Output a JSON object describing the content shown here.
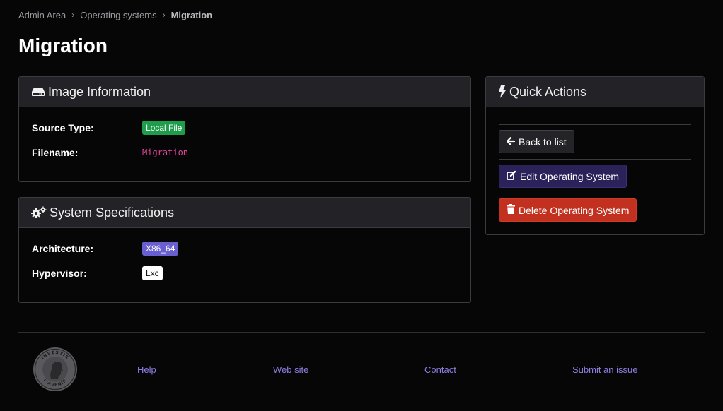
{
  "breadcrumb": {
    "items": [
      "Admin Area",
      "Operating systems"
    ],
    "current": "Migration"
  },
  "page": {
    "title": "Migration"
  },
  "image_info": {
    "title": "Image Information",
    "source_type_label": "Source Type:",
    "source_type_value": "Local File",
    "filename_label": "Filename:",
    "filename_value": "Migration"
  },
  "system_specs": {
    "title": "System Specifications",
    "architecture_label": "Architecture:",
    "architecture_value": "X86_64",
    "hypervisor_label": "Hypervisor:",
    "hypervisor_value": "Lxc"
  },
  "quick_actions": {
    "title": "Quick Actions",
    "back_label": "Back to list",
    "edit_label": "Edit Operating System",
    "delete_label": "Delete Operating System"
  },
  "footer": {
    "links": [
      "Help",
      "Web site",
      "Contact",
      "Submit an issue"
    ],
    "logo_text_top": "INVESTIR",
    "logo_text_bottom": "L'AVENIR"
  },
  "colors": {
    "accent": "#8c7fe0",
    "success": "#1e9e4a",
    "danger": "#c2301f",
    "primary": "#2b2259"
  }
}
